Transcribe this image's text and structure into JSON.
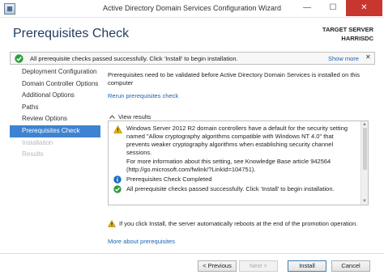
{
  "window": {
    "title": "Active Directory Domain Services Configuration Wizard",
    "minimize_glyph": "—",
    "maximize_glyph": "☐",
    "close_glyph": "✕"
  },
  "header": {
    "page_title": "Prerequisites Check",
    "target_label": "TARGET SERVER",
    "target_server": "HARRISDC"
  },
  "status_bar": {
    "message": "All prerequisite checks passed successfully.  Click 'Install' to begin installation.",
    "show_more": "Show more",
    "chevron": "✕",
    "icon": "success-check-icon"
  },
  "nav": {
    "items": [
      {
        "label": "Deployment Configuration",
        "state": "normal"
      },
      {
        "label": "Domain Controller Options",
        "state": "normal"
      },
      {
        "label": "Additional Options",
        "state": "normal"
      },
      {
        "label": "Paths",
        "state": "normal"
      },
      {
        "label": "Review Options",
        "state": "normal"
      },
      {
        "label": "Prerequisites Check",
        "state": "selected"
      },
      {
        "label": "Installation",
        "state": "disabled"
      },
      {
        "label": "Results",
        "state": "disabled"
      }
    ]
  },
  "content": {
    "intro": "Prerequisites need to be validated before Active Directory Domain Services is installed on this computer",
    "rerun_link": "Rerun prerequisites check",
    "view_results": "View results",
    "results": [
      {
        "icon": "warning-icon",
        "text": "Windows Server 2012 R2 domain controllers have a default for the security setting named \"Allow cryptography algorithms compatible with Windows NT 4.0\" that prevents weaker cryptography algorithms when establishing security channel sessions."
      },
      {
        "icon": "",
        "text": "For more information about this setting, see Knowledge Base article 942564 (http://go.microsoft.com/fwlink/?LinkId=104751)."
      },
      {
        "icon": "info-icon",
        "text": "Prerequisites Check Completed"
      },
      {
        "icon": "success-check-icon",
        "text": "All prerequisite checks passed successfully.  Click 'Install' to begin installation."
      }
    ],
    "footer_warning": "If you click Install, the server automatically reboots at the end of the promotion operation.",
    "more_about_link": "More about prerequisites"
  },
  "buttons": {
    "previous": "< Previous",
    "next": "Next >",
    "install": "Install",
    "cancel": "Cancel"
  },
  "colors": {
    "selected_nav": "#3e83d1",
    "link": "#1a62b5",
    "title": "#1f3b5e",
    "success": "#2e9d3e",
    "warning": "#e8b100",
    "info": "#1c6fbf",
    "close": "#c7372f"
  }
}
